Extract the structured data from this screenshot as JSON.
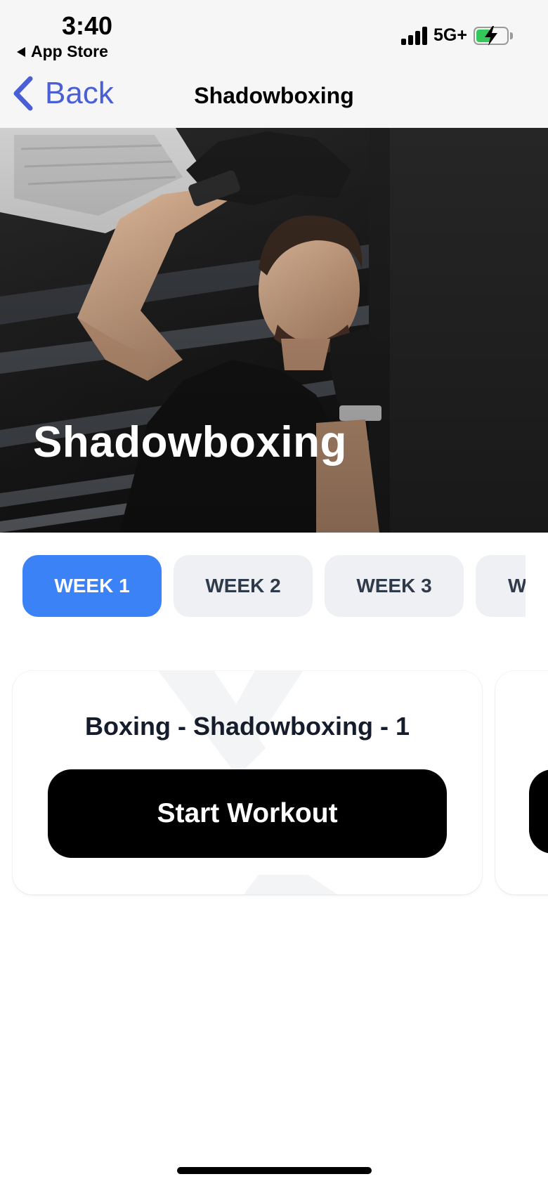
{
  "status_bar": {
    "time": "3:40",
    "back_app": "App Store",
    "network": "5G+",
    "signal_bars": 4,
    "battery_level": 0.5,
    "battery_charging": true
  },
  "nav": {
    "back_label": "Back",
    "title": "Shadowboxing"
  },
  "hero": {
    "title": "Shadowboxing",
    "image_icon": "boxer-photo"
  },
  "weeks": {
    "selected": "WEEK 1",
    "tabs": [
      {
        "label": "WEEK 1"
      },
      {
        "label": "WEEK 2"
      },
      {
        "label": "WEEK 3"
      },
      {
        "label": "W"
      }
    ]
  },
  "workouts": [
    {
      "title": "Boxing - Shadowboxing - 1",
      "button_label": "Start Workout"
    }
  ],
  "colors": {
    "accent": "#3b82f6",
    "nav_link": "#4a5fd6",
    "battery": "#34c759",
    "button": "#000000"
  }
}
